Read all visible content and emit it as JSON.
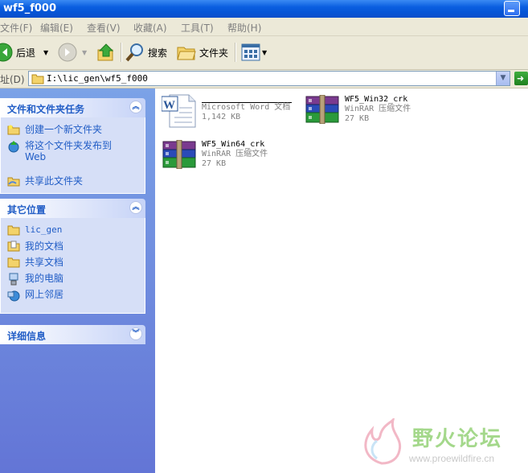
{
  "window": {
    "title": "wf5_f000"
  },
  "menu": [
    {
      "label": "文件(F)"
    },
    {
      "label": "编辑(E)"
    },
    {
      "label": "查看(V)"
    },
    {
      "label": "收藏(A)"
    },
    {
      "label": "工具(T)"
    },
    {
      "label": "帮助(H)"
    }
  ],
  "toolbar": {
    "back_label": "后退",
    "search_label": "搜索",
    "folders_label": "文件夹"
  },
  "address": {
    "label": "地址(D)",
    "value": "I:\\lic_gen\\wf5_f000"
  },
  "sidebar": {
    "tasks": {
      "title": "文件和文件夹任务",
      "items": [
        {
          "label": "创建一个新文件夹"
        },
        {
          "label": "将这个文件夹发布到"
        },
        {
          "label": "Web"
        },
        {
          "label": "共享此文件夹"
        }
      ]
    },
    "places": {
      "title": "其它位置",
      "items": [
        {
          "label": "lic_gen"
        },
        {
          "label": "我的文档"
        },
        {
          "label": "共享文档"
        },
        {
          "label": "我的电脑"
        },
        {
          "label": "网上邻居"
        }
      ]
    },
    "details": {
      "title": "详细信息"
    }
  },
  "files": [
    {
      "name": "",
      "type": "Microsoft Word 文档",
      "size": "1,142 KB",
      "icon": "word-doc-icon"
    },
    {
      "name": "WF5_Win32_crk",
      "type": "WinRAR 压缩文件",
      "size": "27 KB",
      "icon": "winrar-icon"
    },
    {
      "name": "WF5_Win64_crk",
      "type": "WinRAR 压缩文件",
      "size": "27 KB",
      "icon": "winrar-icon"
    }
  ],
  "watermark": {
    "title": "野火论坛",
    "url": "www.proewildfire.cn"
  },
  "colors": {
    "sidebar_link": "#215dc6",
    "titlebar": "#0a5ee0",
    "chrome": "#ece9d8"
  }
}
